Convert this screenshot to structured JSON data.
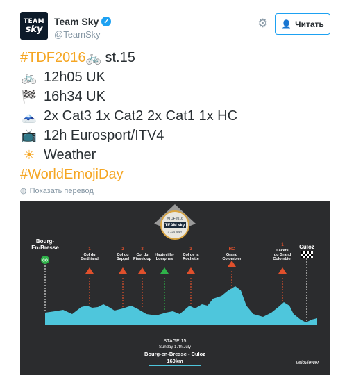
{
  "header": {
    "avatar_line1": "TEAM",
    "avatar_line2": "sky",
    "display_name": "Team Sky",
    "handle": "@TeamSky",
    "follow_label": "Читать"
  },
  "tweet": {
    "line1_hashtag": "#TDF2016",
    "line1_rest": " st.15",
    "line2": "12h05 UK",
    "line3": "16h34 UK",
    "line4": "2x Cat3 1x Cat2 2x Cat1 1x HC",
    "line5": "12h Eurosport/ITV4",
    "line6": "Weather",
    "line7_hashtag": "#WorldEmojiDay",
    "translate_label": "Показать перевод"
  },
  "image": {
    "start_name": "Bourg-\nEn-Bresse",
    "start_badge": "GO",
    "finish_name": "Culoz",
    "badge_top": "#TDF2016",
    "badge_mid": "TEAM sky",
    "badge_bot": "3 - 24 JULY",
    "climbs": [
      {
        "cat": "1",
        "name": "Col du\nBerthiand"
      },
      {
        "cat": "2",
        "name": "Col du\nSappel"
      },
      {
        "cat": "3",
        "name": "Col du\nPisseloup"
      },
      {
        "cat": "",
        "name": "Hauteville-\nLompnes"
      },
      {
        "cat": "3",
        "name": "Col de la\nRochette"
      },
      {
        "cat": "HC",
        "name": "Grand\nColombier"
      },
      {
        "cat": "1",
        "name": "Lacets\ndu Grand\nColombier"
      }
    ],
    "stage": "STAGE 15",
    "date": "Sunday 17th July",
    "route": "Bourg-en-Bresse - Culoz",
    "distance": "160km",
    "brand": "veloviewer"
  },
  "colors": {
    "accent": "#1da1f2",
    "hashtag": "#f5a623",
    "profile": "#4ec6dc",
    "climb_marker": "#e0502c"
  }
}
